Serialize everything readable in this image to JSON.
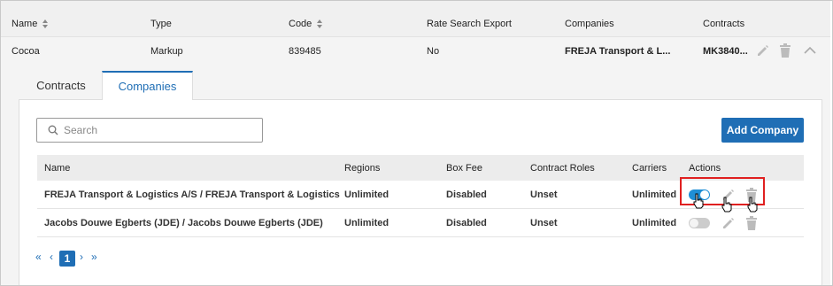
{
  "outer_table": {
    "headers": {
      "name": "Name",
      "type": "Type",
      "code": "Code",
      "rate_search_export": "Rate Search Export",
      "companies": "Companies",
      "contracts": "Contracts"
    },
    "row": {
      "name": "Cocoa",
      "type": "Markup",
      "code": "839485",
      "rate_search_export": "No",
      "companies": "FREJA Transport & L...",
      "contracts": "MK3840..."
    }
  },
  "tabs": [
    {
      "label": "Contracts",
      "active": false
    },
    {
      "label": "Companies",
      "active": true
    }
  ],
  "search": {
    "placeholder": "Search",
    "value": ""
  },
  "add_company_label": "Add Company",
  "companies_table": {
    "headers": {
      "name": "Name",
      "regions": "Regions",
      "box_fee": "Box Fee",
      "contract_roles": "Contract Roles",
      "carriers": "Carriers",
      "actions": "Actions"
    },
    "rows": [
      {
        "name": "FREJA Transport & Logistics A/S / FREJA Transport & Logistics",
        "regions": "Unlimited",
        "box_fee": "Disabled",
        "contract_roles": "Unset",
        "carriers": "Unlimited",
        "toggle_on": true
      },
      {
        "name": "Jacobs Douwe Egberts (JDE) / Jacobs Douwe Egberts (JDE)",
        "regions": "Unlimited",
        "box_fee": "Disabled",
        "contract_roles": "Unset",
        "carriers": "Unlimited",
        "toggle_on": false
      }
    ]
  },
  "pagination": {
    "first": "«",
    "prev": "‹",
    "current_page": "1",
    "next": "›",
    "last": "»"
  },
  "colors": {
    "accent": "#1f6eb5",
    "toggle_on": "#1f8fd6",
    "highlight": "#e02020"
  },
  "icons": [
    "sort-icon",
    "pencil-icon",
    "trash-icon",
    "chevron-up-icon",
    "search-icon",
    "pointer-cursor-icon"
  ]
}
